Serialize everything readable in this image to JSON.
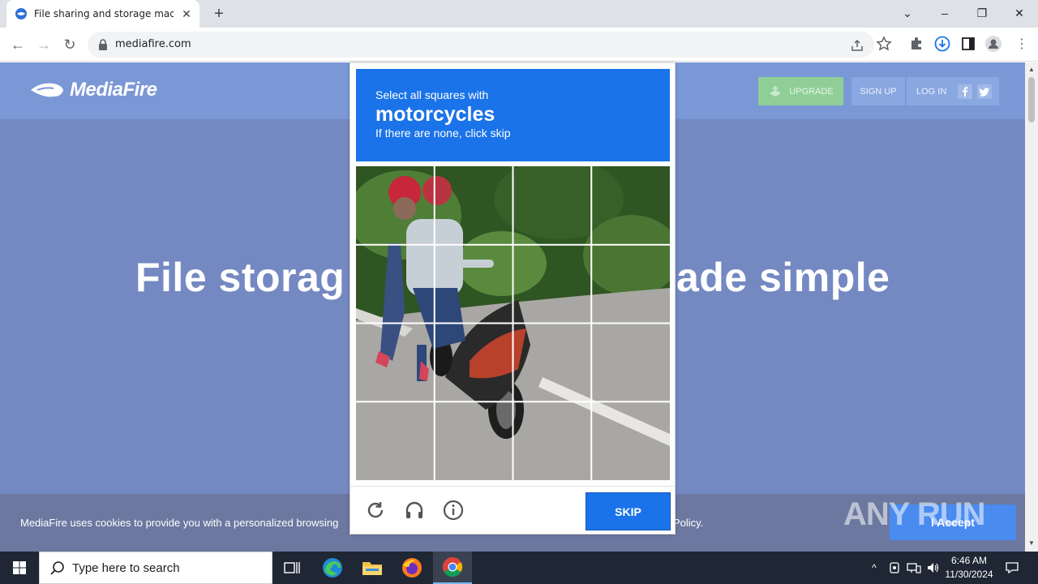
{
  "browser": {
    "tab_title": "File sharing and storage made si",
    "url": "mediafire.com"
  },
  "site": {
    "logo_text": "MediaFire",
    "upgrade_label": "UPGRADE",
    "signup_label": "SIGN UP",
    "login_label": "LOG IN",
    "hero_text": "File storage made simple",
    "hero_left": "File storag",
    "hero_right": "ade simple",
    "cookie_text": "MediaFire uses cookies to provide you with a personalized browsing",
    "cookie_tail": "Policy.",
    "accept_label": "I Accept"
  },
  "captcha": {
    "instruction_line1": "Select all squares with",
    "target": "motorcycles",
    "instruction_line2": "If there are none, click skip",
    "grid": {
      "rows": 4,
      "cols": 4
    },
    "skip_label": "SKIP"
  },
  "watermark": "ANY RUN",
  "taskbar": {
    "search_placeholder": "Type here to search",
    "time": "6:46 AM",
    "date": "11/30/2024"
  },
  "colors": {
    "captcha_accent": "#1a73e8",
    "page_overlay": "#7488c2",
    "upgrade_green": "#8fcf97"
  }
}
